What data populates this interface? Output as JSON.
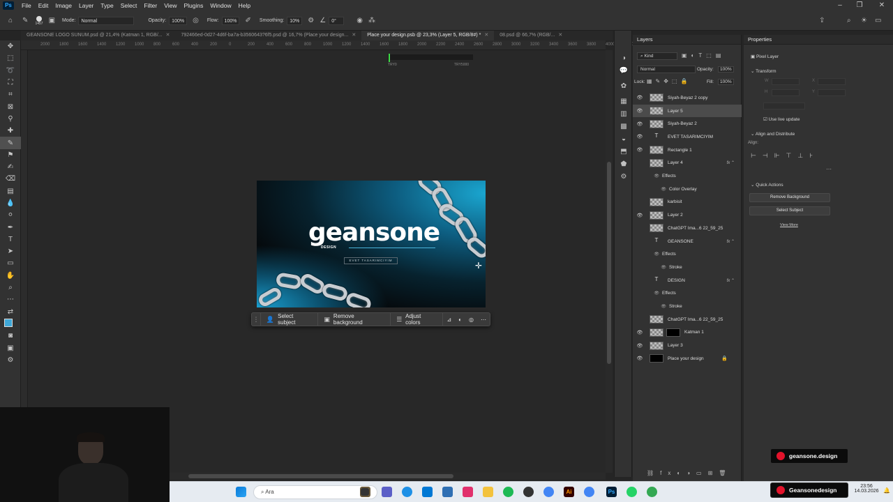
{
  "menubar": {
    "items": [
      "File",
      "Edit",
      "Image",
      "Layer",
      "Type",
      "Select",
      "Filter",
      "View",
      "Plugins",
      "Window",
      "Help"
    ]
  },
  "options": {
    "mode_label": "Mode:",
    "mode_value": "Normal",
    "opacity_label": "Opacity:",
    "opacity_value": "100%",
    "flow_label": "Flow:",
    "flow_value": "100%",
    "smoothing_label": "Smoothing:",
    "smoothing_value": "10%",
    "angle_value": "0°",
    "brush_size": "1457"
  },
  "tabs": [
    {
      "label": "GEANSONE LOGO SUNUM.psd @ 21,4% (Katman 1, RGB/...",
      "active": false
    },
    {
      "label": "792466ed-0d27-4d6f-ba7a-b3560643?6f5.psd @ 16,7% (Place your design...",
      "active": false
    },
    {
      "label": "Place your design.psb @ 23,3% (Layer 5, RGB/8#) *",
      "active": true
    },
    {
      "label": "08.psd @ 66,7% (RGB/...",
      "active": false
    }
  ],
  "ruler": [
    "2000",
    "1800",
    "1600",
    "1400",
    "1200",
    "1000",
    "800",
    "600",
    "400",
    "200",
    "0",
    "200",
    "400",
    "600",
    "800",
    "1000",
    "1200",
    "1400",
    "1600",
    "1800",
    "2000",
    "2200",
    "2400",
    "2600",
    "2800",
    "3000",
    "3200",
    "3400",
    "3600",
    "3800",
    "4000",
    "4200"
  ],
  "mini_ui": {
    "left": "TRY0",
    "right": "TRY5000"
  },
  "artwork": {
    "logo": "geansone",
    "sub": "DESIGN",
    "tagline": "EVET TASARIMCIYIM"
  },
  "contextbar": {
    "select_subject": "Select subject",
    "remove_background": "Remove background",
    "adjust_colors": "Adjust colors"
  },
  "layers": {
    "title": "Layers",
    "kind": "Kind",
    "blend": "Normal",
    "opacity_label": "Opacity:",
    "opacity": "100%",
    "lock_label": "Lock:",
    "fill_label": "Fill:",
    "fill": "100%",
    "rows": [
      {
        "name": "Siyah-Beyaz 2 copy",
        "kind": "adj",
        "eye": true
      },
      {
        "name": "Layer 5",
        "kind": "pixel",
        "eye": true,
        "selected": true
      },
      {
        "name": "Siyah-Beyaz 2",
        "kind": "adj",
        "eye": true
      },
      {
        "name": "EVET TASARIMCIYIM",
        "kind": "text",
        "eye": true
      },
      {
        "name": "Rectangle 1",
        "kind": "shape",
        "eye": true
      },
      {
        "name": "Layer 4",
        "kind": "pixel",
        "eye": false,
        "fx": true
      },
      {
        "name": "Effects",
        "kind": "sub"
      },
      {
        "name": "Color Overlay",
        "kind": "sub2"
      },
      {
        "name": "karbisit",
        "kind": "adj",
        "eye": false
      },
      {
        "name": "Layer 2",
        "kind": "pixel",
        "eye": true
      },
      {
        "name": "ChatGPT Ima...6 22_59_25",
        "kind": "smart",
        "eye": false
      },
      {
        "name": "GEANSONE",
        "kind": "text",
        "eye": false,
        "fx": true
      },
      {
        "name": "Effects",
        "kind": "sub"
      },
      {
        "name": "Stroke",
        "kind": "sub2"
      },
      {
        "name": "DESIGN",
        "kind": "text",
        "eye": false,
        "fx": true
      },
      {
        "name": "Effects",
        "kind": "sub"
      },
      {
        "name": "Stroke",
        "kind": "sub2"
      },
      {
        "name": "ChatGPT Ima...6 22_59_25",
        "kind": "smart",
        "eye": false
      },
      {
        "name": "Katman 1",
        "kind": "masked",
        "eye": true
      },
      {
        "name": "Layer 3",
        "kind": "pixel",
        "eye": true
      },
      {
        "name": "Place your design",
        "kind": "black",
        "eye": true,
        "locked": true
      }
    ]
  },
  "properties": {
    "title": "Properties",
    "pixel_layer": "Pixel Layer",
    "transform": "Transform",
    "w": "W",
    "h": "H",
    "x": "X",
    "y": "Y",
    "live_update": "Use live update",
    "align_dist": "Align and Distribute",
    "align": "Align:",
    "quick_actions": "Quick Actions",
    "remove_bg": "Remove Background",
    "select_subject": "Select Subject",
    "view_more": "View More"
  },
  "brands": {
    "top": "geansone.design",
    "bottom": "Geansonedesign"
  },
  "taskbar": {
    "search": "Ara",
    "time": "23:56",
    "date": "14.03.2026"
  }
}
